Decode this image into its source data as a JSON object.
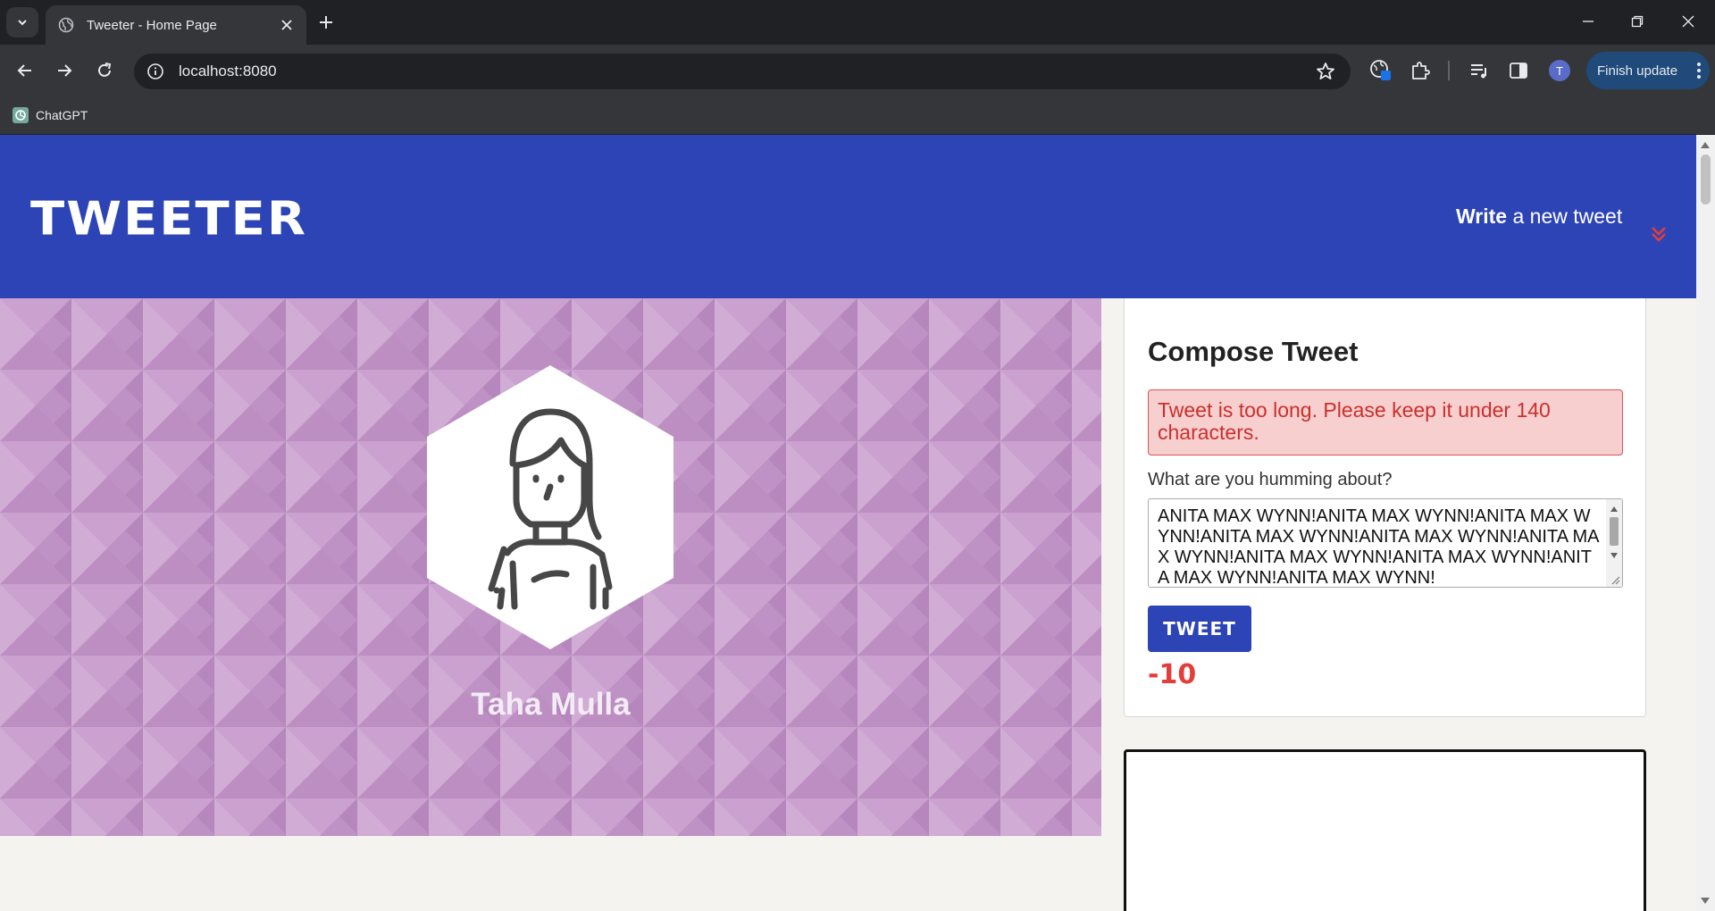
{
  "browser": {
    "tab_title": "Tweeter - Home Page",
    "url": "localhost:8080",
    "bookmark_label": "ChatGPT",
    "profile_initial": "T",
    "finish_update_label": "Finish update"
  },
  "header": {
    "logo": "TWEETER",
    "write_bold": "Write",
    "write_rest": " a new tweet",
    "accent_color": "#e43e3a",
    "brand_color": "#2d44b6"
  },
  "profile": {
    "name": "Taha Mulla",
    "banner_color": "#c294c8"
  },
  "compose": {
    "title": "Compose Tweet",
    "error": "Tweet is too long. Please keep it under 140 characters.",
    "label": "What are you humming about?",
    "text": "ANITA MAX WYNN!ANITA MAX WYNN!ANITA MAX WYNN!ANITA MAX WYNN!ANITA MAX WYNN!ANITA MAX WYNN!ANITA MAX WYNN!ANITA MAX WYNN!ANITA MAX WYNN!ANITA MAX WYNN!",
    "button": "TWEET",
    "counter": "-10"
  }
}
